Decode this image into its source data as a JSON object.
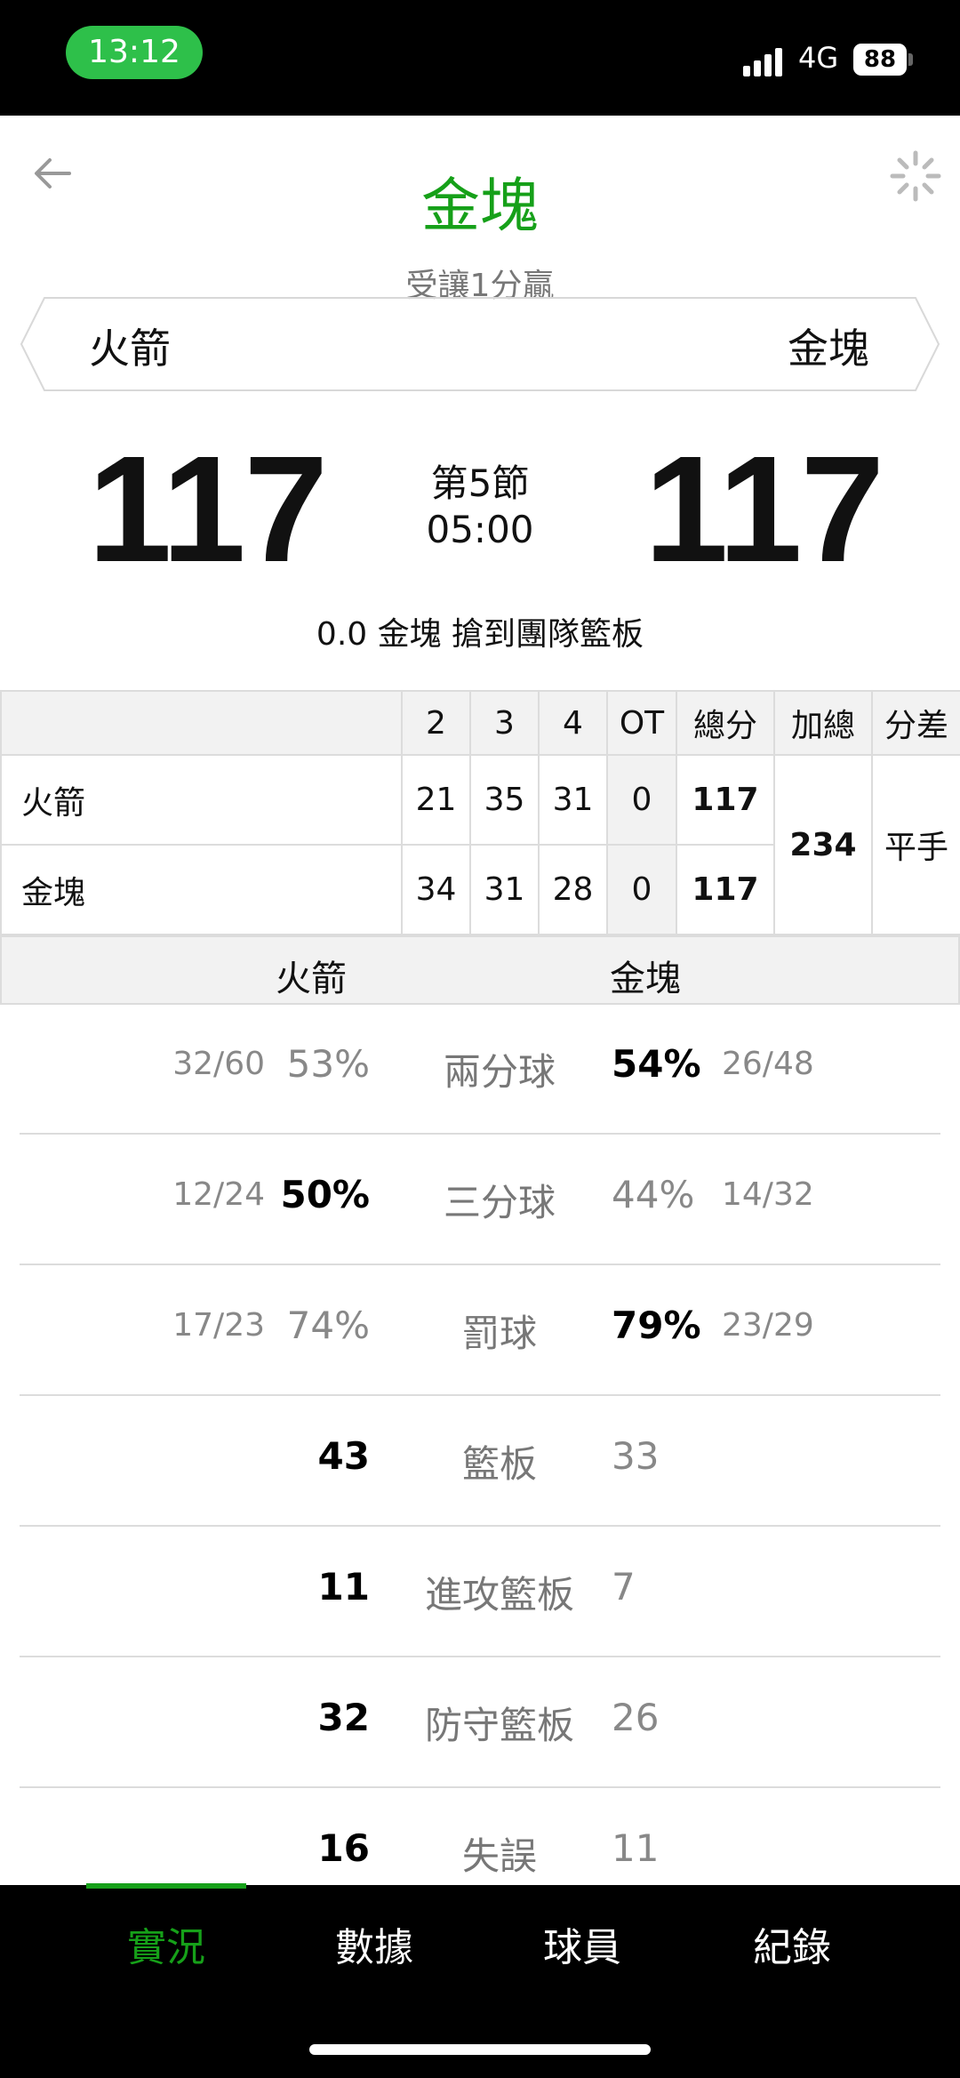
{
  "status": {
    "time": "13:12",
    "network": "4G",
    "battery": "88"
  },
  "header": {
    "title": "金塊",
    "handicap": "受讓1分贏",
    "team_left": "火箭",
    "team_right": "金塊"
  },
  "score": {
    "left": "117",
    "right": "117",
    "period": "第5節",
    "clock": "05:00",
    "last_event": "0.0 金塊  搶到團隊籃板"
  },
  "box": {
    "headers": [
      "",
      "2",
      "3",
      "4",
      "OT",
      "總分",
      "加總",
      "分差"
    ],
    "rows": [
      {
        "team": "火箭",
        "q2": "21",
        "q3": "35",
        "q4": "31",
        "ot": "0",
        "total": "117"
      },
      {
        "team": "金塊",
        "q2": "34",
        "q3": "31",
        "q4": "28",
        "ot": "0",
        "total": "117"
      }
    ],
    "sum": "234",
    "diff": "平手"
  },
  "compare": {
    "left_team": "火箭",
    "right_team": "金塊"
  },
  "stats": [
    {
      "label": "兩分球",
      "left_frac": "32/60",
      "left": "53%",
      "right": "54%",
      "right_frac": "26/48"
    },
    {
      "label": "三分球",
      "left_frac": "12/24",
      "left": "50%",
      "right": "44%",
      "right_frac": "14/32"
    },
    {
      "label": "罰球",
      "left_frac": "17/23",
      "left": "74%",
      "right": "79%",
      "right_frac": "23/29"
    },
    {
      "label": "籃板",
      "left_frac": "",
      "left": "43",
      "right": "33",
      "right_frac": ""
    },
    {
      "label": "進攻籃板",
      "left_frac": "",
      "left": "11",
      "right": "7",
      "right_frac": ""
    },
    {
      "label": "防守籃板",
      "left_frac": "",
      "left": "32",
      "right": "26",
      "right_frac": ""
    },
    {
      "label": "失誤",
      "left_frac": "",
      "left": "16",
      "right": "11",
      "right_frac": ""
    }
  ],
  "tabs": [
    "實況",
    "數據",
    "球員",
    "紀錄"
  ],
  "colors": {
    "accent": "#16a019",
    "status_pill": "#2ec04a"
  }
}
